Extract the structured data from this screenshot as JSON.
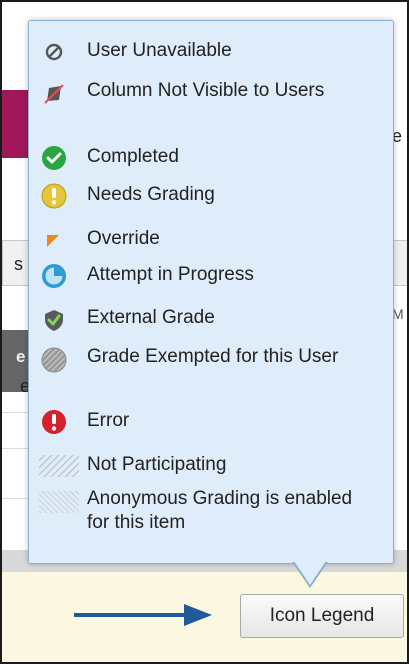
{
  "background": {
    "left_tab_text": "s",
    "right_edge_letter": "e",
    "column_letter_m": "M",
    "dark_row_text": "e",
    "row_letter_e": "e"
  },
  "legend": {
    "items": [
      {
        "icon": "user-unavailable-icon",
        "label": "User Unavailable"
      },
      {
        "icon": "column-not-visible-icon",
        "label": "Column Not Visible to Users"
      },
      {
        "icon": "completed-icon",
        "label": "Completed"
      },
      {
        "icon": "needs-grading-icon",
        "label": "Needs Grading"
      },
      {
        "icon": "override-icon",
        "label": "Override"
      },
      {
        "icon": "attempt-in-progress-icon",
        "label": "Attempt in Progress"
      },
      {
        "icon": "external-grade-icon",
        "label": "External Grade"
      },
      {
        "icon": "grade-exempted-icon",
        "label": "Grade Exempted for this User"
      },
      {
        "icon": "error-icon",
        "label": "Error"
      },
      {
        "icon": "not-participating-icon",
        "label": "Not Participating"
      },
      {
        "icon": "anonymous-grading-icon",
        "label": "Anonymous Grading is enabled for this item"
      }
    ]
  },
  "button": {
    "label": "Icon Legend"
  },
  "colors": {
    "popup_bg": "#deedf9",
    "arrow": "#1f5b99",
    "completed": "#2aa640",
    "needs_grading": "#e3c63a",
    "override": "#e88a1a",
    "in_progress": "#2d9ad8",
    "error": "#d6202a",
    "band": "#a0185a"
  }
}
